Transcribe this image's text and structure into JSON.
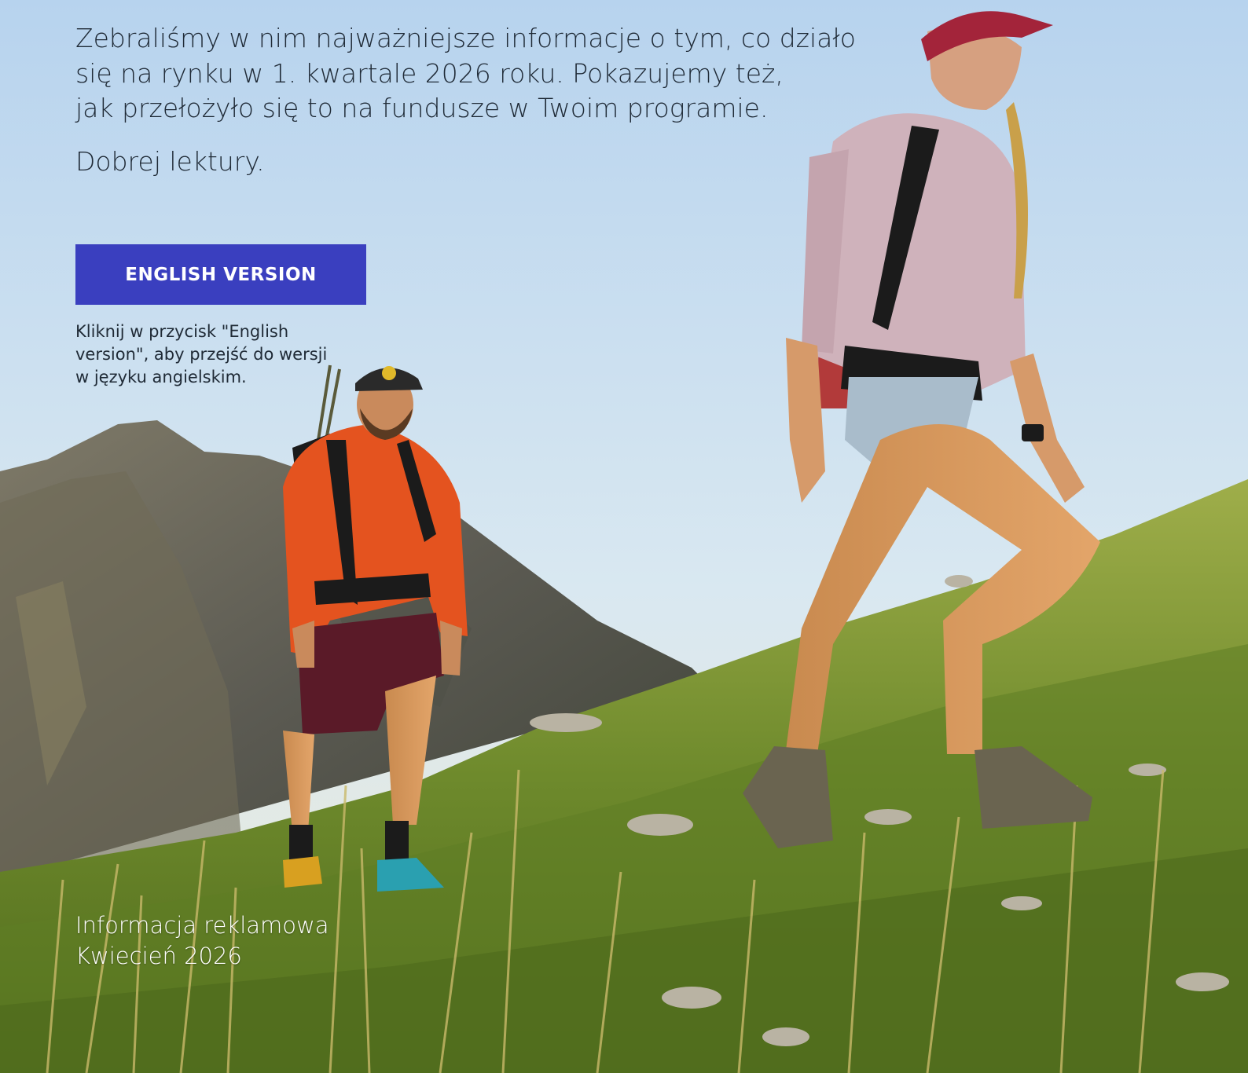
{
  "intro": {
    "lines": [
      "Zebraliśmy w nim najważniejsze informacje o tym, co działo",
      "się na rynku w 1. kwartale 2026 roku. Pokazujemy też,",
      "jak przełożyło się to na fundusze w Twoim programie."
    ],
    "greeting": "Dobrej lektury."
  },
  "cta": {
    "button_label": "ENGLISH VERSION",
    "hint": "Kliknij w przycisk \"English version\", aby przejść do wersji w języku angielskim."
  },
  "footer": {
    "ad_label": "Informacja reklamowa",
    "date": "Kwiecień 2026"
  },
  "colors": {
    "button": "#3a3fbf",
    "text_dark": "#1f2a36",
    "text_light": "#ffffff",
    "sky_top": "#b8d4ee",
    "grass": "#7a9a3a"
  }
}
